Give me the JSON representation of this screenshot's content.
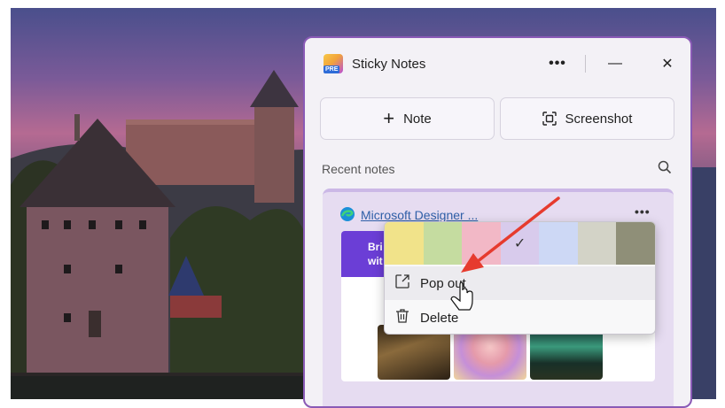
{
  "window": {
    "title": "Sticky Notes",
    "logo_badge": "PRE",
    "accent": "#8a5ab6"
  },
  "toolbar": {
    "more_label": "•••",
    "minimize_label": "—",
    "close_label": "✕"
  },
  "actions": {
    "note_label": "Note",
    "screenshot_label": "Screenshot"
  },
  "recent": {
    "label": "Recent notes"
  },
  "note": {
    "source_link": "Microsoft Designer ...",
    "more_label": "•••",
    "preview_text": "Bri\nwit"
  },
  "context_menu": {
    "colors": [
      "#f1e38a",
      "#c5dca0",
      "#f2b8c6",
      "#d8cbec",
      "#cdd8f5",
      "#d3d3c7",
      "#8f8f78"
    ],
    "selected_color_index": 3,
    "items": [
      {
        "label": "Pop out",
        "icon": "popout-icon"
      },
      {
        "label": "Delete",
        "icon": "trash-icon"
      }
    ]
  }
}
